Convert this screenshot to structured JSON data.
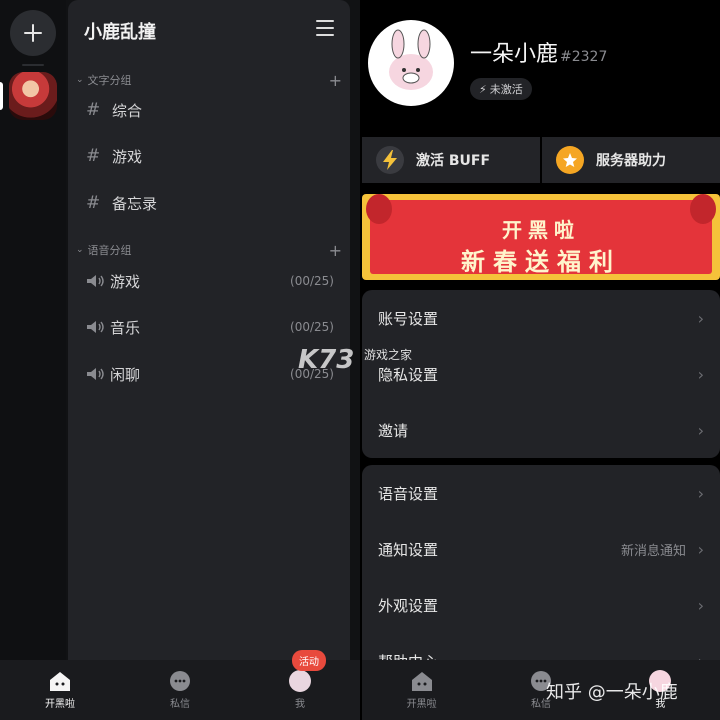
{
  "left": {
    "server_title": "小鹿乱撞",
    "text_group": {
      "label": "文字分组",
      "channels": [
        "综合",
        "游戏",
        "备忘录"
      ]
    },
    "voice_group": {
      "label": "语音分组",
      "channels": [
        {
          "name": "游戏",
          "count": "(00/25)"
        },
        {
          "name": "音乐",
          "count": "(00/25)"
        },
        {
          "name": "闲聊",
          "count": "(00/25)"
        }
      ]
    },
    "nav": {
      "home": "开黑啦",
      "dm": "私信",
      "me": "我",
      "badge": "活动"
    }
  },
  "right": {
    "username": "一朵小鹿",
    "tag": "#2327",
    "status": "未激活",
    "actions": {
      "buff": "激活 BUFF",
      "boost": "服务器助力"
    },
    "banner": {
      "line1": "开黑啦",
      "line2": "新春送福利"
    },
    "section1": [
      "账号设置",
      "隐私设置",
      "邀请"
    ],
    "section2": [
      {
        "label": "语音设置",
        "extra": ""
      },
      {
        "label": "通知设置",
        "extra": "新消息通知"
      },
      {
        "label": "外观设置",
        "extra": ""
      },
      {
        "label": "帮助中心",
        "extra": ""
      }
    ],
    "nav": {
      "home": "开黑啦",
      "dm": "私信",
      "me": "我"
    }
  },
  "watermarks": {
    "k73": "K73",
    "k73_sub": "游戏之家",
    "zhihu": "知乎 @一朵小鹿"
  },
  "colors": {
    "panel": "#222327",
    "background": "#000000",
    "badge": "#e84a3d",
    "banner": "#e4343a"
  }
}
